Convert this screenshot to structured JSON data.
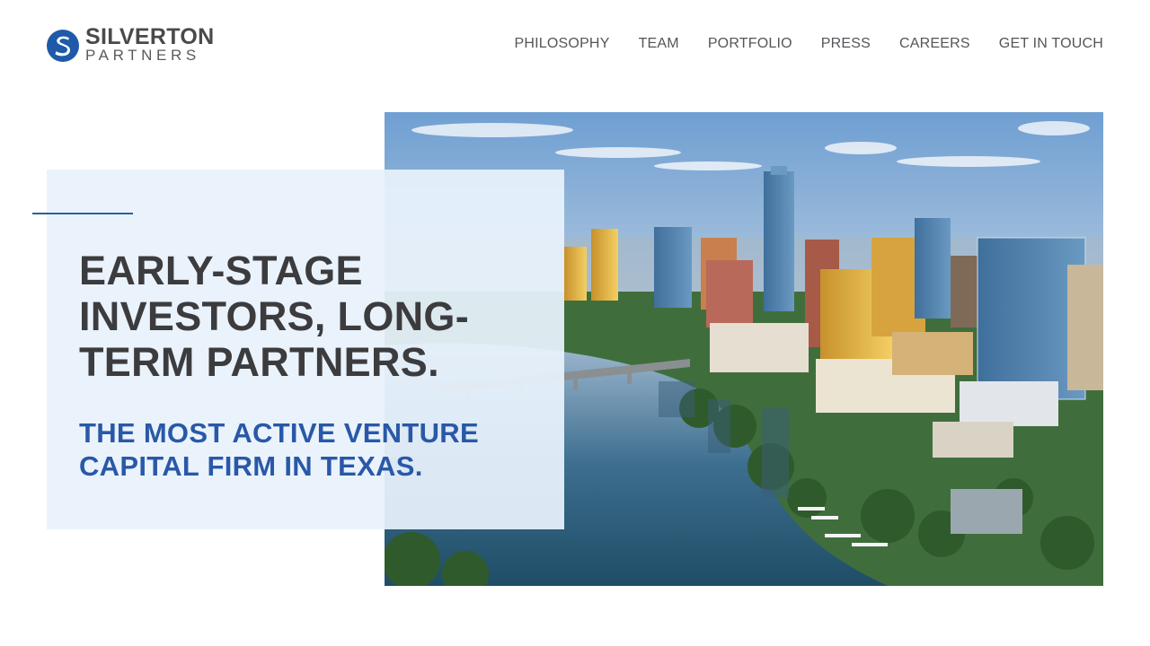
{
  "brand": {
    "logo_icon": "s-monogram-circle-icon",
    "name_top": "SILVERTON",
    "name_bottom": "PARTNERS",
    "color": "#1e5aa8"
  },
  "nav": {
    "items": [
      {
        "label": "PHILOSOPHY"
      },
      {
        "label": "TEAM"
      },
      {
        "label": "PORTFOLIO"
      },
      {
        "label": "PRESS"
      },
      {
        "label": "CAREERS"
      },
      {
        "label": "GET IN TOUCH"
      }
    ]
  },
  "hero": {
    "headline": "EARLY-STAGE INVESTORS, LONG-TERM PARTNERS.",
    "subheadline": "THE MOST ACTIVE VENTURE CAPITAL FIRM IN TEXAS.",
    "image_subject": "austin-skyline-river-aerial",
    "headline_color": "#3c3c3e",
    "subheadline_color": "#2a58a8",
    "panel_color": "#e8f2fc"
  }
}
